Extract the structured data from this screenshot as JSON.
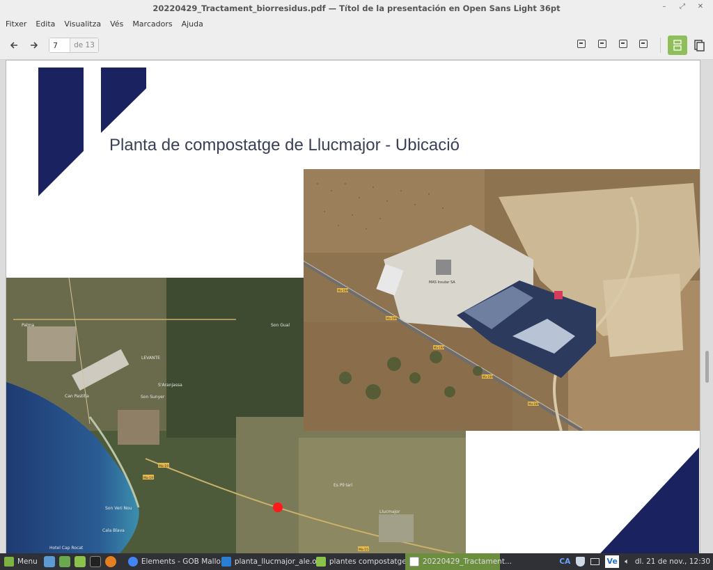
{
  "window": {
    "title": "20220429_Tractament_biorresidus.pdf — Títol de la presentación en Open Sans Light 36pt",
    "controls": [
      "minimize-icon",
      "maximize-icon",
      "close-icon"
    ]
  },
  "menu": {
    "items": [
      "Fitxer",
      "Edita",
      "Visualitza",
      "Vés",
      "Marcadors",
      "Ajuda"
    ]
  },
  "toolbar": {
    "page_current": "7",
    "page_of": "de 13"
  },
  "document": {
    "slide_title": "Planta de compostatge de Llucmajor - Ubicació",
    "colors": {
      "navy": "#1b2260",
      "title": "#3a4157"
    },
    "map_labels": [
      "MAS Insular SA",
      "Ma-19A",
      "Ma-19A",
      "Ma-19A",
      "Ma-19A",
      "Ma-19A",
      "Son Gual",
      "LEVANTE",
      "S'Aranjassa",
      "Son Sunyer",
      "Can Pastilla",
      "Son Veri Nou",
      "Cala Blava",
      "Hotel Cap Rocat",
      "Llucmajor",
      "Es Pil·larí",
      "Palma",
      "Ma-19",
      "Ma-15",
      "Ma-19"
    ]
  },
  "taskbar": {
    "menu_label": "Menu",
    "items": [
      {
        "label": "Elements - GOB Mallor...",
        "icon": "chrome-icon"
      },
      {
        "label": "planta_llucmajor_ale.o...",
        "icon": "document-icon"
      },
      {
        "label": "plantes compostatge. ...",
        "icon": "folder-icon"
      },
      {
        "label": "20220429_Tractament...",
        "icon": "pdf-icon",
        "active": true
      }
    ],
    "tray": {
      "lang": "CA",
      "clock": "dl. 21 de nov., 12:30"
    }
  }
}
